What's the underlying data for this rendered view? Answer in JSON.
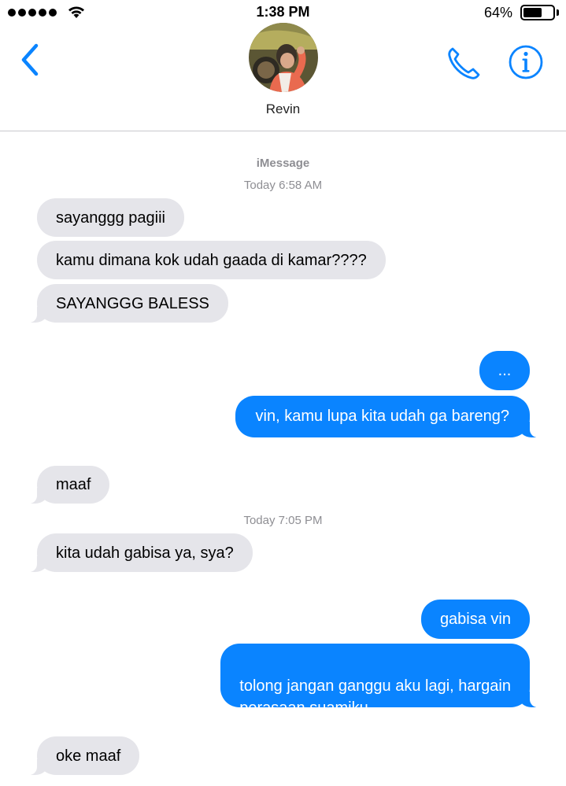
{
  "status_bar": {
    "time": "1:38 PM",
    "battery": "64%",
    "battery_level": 0.64
  },
  "contact": {
    "name": "Revin"
  },
  "thread": {
    "service": "iMessage",
    "timestamps": [
      "Today 6:58 AM",
      "Today 7:05 PM"
    ],
    "messages": [
      {
        "from": "them",
        "text": "sayanggg pagiii"
      },
      {
        "from": "them",
        "text": "kamu dimana kok udah gaada di kamar????"
      },
      {
        "from": "them",
        "text": "SAYANGGG BALESS"
      },
      {
        "from": "me",
        "text": "..."
      },
      {
        "from": "me",
        "text": "vin, kamu lupa kita udah ga bareng?"
      },
      {
        "from": "them",
        "text": "maaf"
      },
      {
        "from": "them",
        "text": "kita udah gabisa ya, sya?"
      },
      {
        "from": "me",
        "text": "gabisa vin"
      },
      {
        "from": "me",
        "text": "tolong jangan ganggu aku lagi, hargain\nperasaan suamiku"
      },
      {
        "from": "them",
        "text": "oke maaf"
      }
    ]
  },
  "colors": {
    "accent": "#0a84ff",
    "incoming_bubble": "#e5e5ea",
    "outgoing_bubble": "#0a84ff",
    "meta_text": "#8e8e93"
  },
  "icons": {
    "back": "chevron-left-icon",
    "call": "phone-icon",
    "info": "info-icon",
    "wifi": "wifi-icon",
    "battery": "battery-icon"
  }
}
